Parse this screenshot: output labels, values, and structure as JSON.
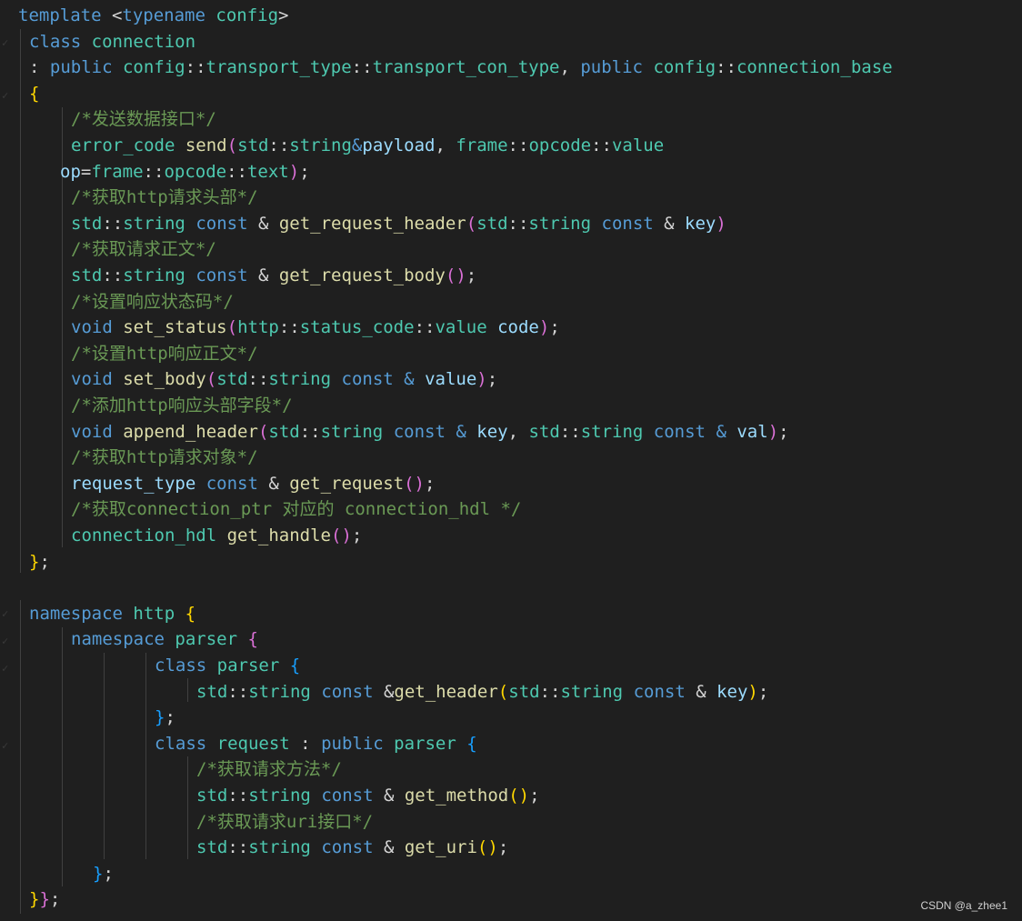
{
  "colors": {
    "background": "#1f1f1f",
    "keyword": "#569cd6",
    "type": "#4ec9b0",
    "function": "#dcdcaa",
    "variable": "#9cdcfe",
    "comment": "#6a9955",
    "punctuation": "#d4d4d4",
    "bracket_1": "#ffd700",
    "bracket_2": "#da70d6",
    "bracket_3": "#179fff"
  },
  "watermark": "CSDN @a_zhee1",
  "code_lines": [
    [
      [
        "kw",
        "template"
      ],
      [
        "punc",
        " <"
      ],
      [
        "kw",
        "typename"
      ],
      [
        "punc",
        " "
      ],
      [
        "type",
        "config"
      ],
      [
        "punc",
        ">"
      ]
    ],
    [
      [
        "kw",
        "class"
      ],
      [
        "punc",
        " "
      ],
      [
        "type",
        "connection"
      ]
    ],
    [
      [
        "punc",
        ": "
      ],
      [
        "kw",
        "public"
      ],
      [
        "punc",
        " "
      ],
      [
        "type",
        "config"
      ],
      [
        "punc",
        "::"
      ],
      [
        "type",
        "transport_type"
      ],
      [
        "punc",
        "::"
      ],
      [
        "type",
        "transport_con_type"
      ],
      [
        "punc",
        ", "
      ],
      [
        "kw",
        "public"
      ],
      [
        "punc",
        " "
      ],
      [
        "type",
        "config"
      ],
      [
        "punc",
        "::"
      ],
      [
        "type",
        "connection_base"
      ]
    ],
    [
      [
        "br1",
        "{"
      ]
    ],
    [
      [
        "com",
        "/*发送数据接口*/"
      ]
    ],
    [
      [
        "type",
        "error_code"
      ],
      [
        "punc",
        " "
      ],
      [
        "func",
        "send"
      ],
      [
        "br2",
        "("
      ],
      [
        "type",
        "std"
      ],
      [
        "punc",
        "::"
      ],
      [
        "type",
        "string"
      ],
      [
        "kw",
        "&"
      ],
      [
        "var",
        "payload"
      ],
      [
        "punc",
        ", "
      ],
      [
        "type",
        "frame"
      ],
      [
        "punc",
        "::"
      ],
      [
        "type",
        "opcode"
      ],
      [
        "punc",
        "::"
      ],
      [
        "type",
        "value"
      ]
    ],
    [
      [
        "var",
        "op"
      ],
      [
        "punc",
        "="
      ],
      [
        "type",
        "frame"
      ],
      [
        "punc",
        "::"
      ],
      [
        "type",
        "opcode"
      ],
      [
        "punc",
        "::"
      ],
      [
        "type",
        "text"
      ],
      [
        "br2",
        ")"
      ],
      [
        "punc",
        ";"
      ]
    ],
    [
      [
        "com",
        "/*获取http请求头部*/"
      ]
    ],
    [
      [
        "type",
        "std"
      ],
      [
        "punc",
        "::"
      ],
      [
        "type",
        "string"
      ],
      [
        "punc",
        " "
      ],
      [
        "kw",
        "const"
      ],
      [
        "punc",
        " & "
      ],
      [
        "func",
        "get_request_header"
      ],
      [
        "br2",
        "("
      ],
      [
        "type",
        "std"
      ],
      [
        "punc",
        "::"
      ],
      [
        "type",
        "string"
      ],
      [
        "punc",
        " "
      ],
      [
        "kw",
        "const"
      ],
      [
        "punc",
        " & "
      ],
      [
        "var",
        "key"
      ],
      [
        "br2",
        ")"
      ]
    ],
    [
      [
        "com",
        "/*获取请求正文*/"
      ]
    ],
    [
      [
        "type",
        "std"
      ],
      [
        "punc",
        "::"
      ],
      [
        "type",
        "string"
      ],
      [
        "punc",
        " "
      ],
      [
        "kw",
        "const"
      ],
      [
        "punc",
        " & "
      ],
      [
        "func",
        "get_request_body"
      ],
      [
        "br2",
        "()"
      ],
      [
        "punc",
        ";"
      ]
    ],
    [
      [
        "com",
        "/*设置响应状态码*/"
      ]
    ],
    [
      [
        "kw",
        "void"
      ],
      [
        "punc",
        " "
      ],
      [
        "func",
        "set_status"
      ],
      [
        "br2",
        "("
      ],
      [
        "type",
        "http"
      ],
      [
        "punc",
        "::"
      ],
      [
        "type",
        "status_code"
      ],
      [
        "punc",
        "::"
      ],
      [
        "type",
        "value"
      ],
      [
        "punc",
        " "
      ],
      [
        "var",
        "code"
      ],
      [
        "br2",
        ")"
      ],
      [
        "punc",
        ";"
      ]
    ],
    [
      [
        "com",
        "/*设置http响应正文*/"
      ]
    ],
    [
      [
        "kw",
        "void"
      ],
      [
        "punc",
        " "
      ],
      [
        "func",
        "set_body"
      ],
      [
        "br2",
        "("
      ],
      [
        "type",
        "std"
      ],
      [
        "punc",
        "::"
      ],
      [
        "type",
        "string"
      ],
      [
        "punc",
        " "
      ],
      [
        "kw",
        "const"
      ],
      [
        "punc",
        " "
      ],
      [
        "kw",
        "&"
      ],
      [
        "punc",
        " "
      ],
      [
        "var",
        "value"
      ],
      [
        "br2",
        ")"
      ],
      [
        "punc",
        ";"
      ]
    ],
    [
      [
        "com",
        "/*添加http响应头部字段*/"
      ]
    ],
    [
      [
        "kw",
        "void"
      ],
      [
        "punc",
        " "
      ],
      [
        "func",
        "append_header"
      ],
      [
        "br2",
        "("
      ],
      [
        "type",
        "std"
      ],
      [
        "punc",
        "::"
      ],
      [
        "type",
        "string"
      ],
      [
        "punc",
        " "
      ],
      [
        "kw",
        "const"
      ],
      [
        "punc",
        " "
      ],
      [
        "kw",
        "&"
      ],
      [
        "punc",
        " "
      ],
      [
        "var",
        "key"
      ],
      [
        "punc",
        ", "
      ],
      [
        "type",
        "std"
      ],
      [
        "punc",
        "::"
      ],
      [
        "type",
        "string"
      ],
      [
        "punc",
        " "
      ],
      [
        "kw",
        "const"
      ],
      [
        "punc",
        " "
      ],
      [
        "kw",
        "&"
      ],
      [
        "punc",
        " "
      ],
      [
        "var",
        "val"
      ],
      [
        "br2",
        ")"
      ],
      [
        "punc",
        ";"
      ]
    ],
    [
      [
        "com",
        "/*获取http请求对象*/"
      ]
    ],
    [
      [
        "var",
        "request_type"
      ],
      [
        "punc",
        " "
      ],
      [
        "kw",
        "const"
      ],
      [
        "punc",
        " & "
      ],
      [
        "func",
        "get_request"
      ],
      [
        "br2",
        "()"
      ],
      [
        "punc",
        ";"
      ]
    ],
    [
      [
        "com",
        "/*获取connection_ptr 对应的 connection_hdl */"
      ]
    ],
    [
      [
        "type",
        "connection_hdl"
      ],
      [
        "punc",
        " "
      ],
      [
        "func",
        "get_handle"
      ],
      [
        "br2",
        "()"
      ],
      [
        "punc",
        ";"
      ]
    ],
    [
      [
        "br1",
        "}"
      ],
      [
        "punc",
        ";"
      ]
    ],
    [],
    [
      [
        "kw",
        "namespace"
      ],
      [
        "punc",
        " "
      ],
      [
        "type",
        "http"
      ],
      [
        "punc",
        " "
      ],
      [
        "br1",
        "{"
      ]
    ],
    [
      [
        "kw",
        "namespace"
      ],
      [
        "punc",
        " "
      ],
      [
        "type",
        "parser"
      ],
      [
        "punc",
        " "
      ],
      [
        "br2",
        "{"
      ]
    ],
    [
      [
        "kw",
        "class"
      ],
      [
        "punc",
        " "
      ],
      [
        "type",
        "parser"
      ],
      [
        "punc",
        " "
      ],
      [
        "br3",
        "{"
      ]
    ],
    [
      [
        "type",
        "std"
      ],
      [
        "punc",
        "::"
      ],
      [
        "type",
        "string"
      ],
      [
        "punc",
        " "
      ],
      [
        "kw",
        "const"
      ],
      [
        "punc",
        " &"
      ],
      [
        "func",
        "get_header"
      ],
      [
        "br1",
        "("
      ],
      [
        "type",
        "std"
      ],
      [
        "punc",
        "::"
      ],
      [
        "type",
        "string"
      ],
      [
        "punc",
        " "
      ],
      [
        "kw",
        "const"
      ],
      [
        "punc",
        " & "
      ],
      [
        "var",
        "key"
      ],
      [
        "br1",
        ")"
      ],
      [
        "punc",
        ";"
      ]
    ],
    [
      [
        "br3",
        "}"
      ],
      [
        "punc",
        ";"
      ]
    ],
    [
      [
        "kw",
        "class"
      ],
      [
        "punc",
        " "
      ],
      [
        "type",
        "request"
      ],
      [
        "punc",
        " : "
      ],
      [
        "kw",
        "public"
      ],
      [
        "punc",
        " "
      ],
      [
        "type",
        "parser"
      ],
      [
        "punc",
        " "
      ],
      [
        "br3",
        "{"
      ]
    ],
    [
      [
        "com",
        "/*获取请求方法*/"
      ]
    ],
    [
      [
        "type",
        "std"
      ],
      [
        "punc",
        "::"
      ],
      [
        "type",
        "string"
      ],
      [
        "punc",
        " "
      ],
      [
        "kw",
        "const"
      ],
      [
        "punc",
        " & "
      ],
      [
        "func",
        "get_method"
      ],
      [
        "br1",
        "()"
      ],
      [
        "punc",
        ";"
      ]
    ],
    [
      [
        "com",
        "/*获取请求uri接口*/"
      ]
    ],
    [
      [
        "type",
        "std"
      ],
      [
        "punc",
        "::"
      ],
      [
        "type",
        "string"
      ],
      [
        "punc",
        " "
      ],
      [
        "kw",
        "const"
      ],
      [
        "punc",
        " & "
      ],
      [
        "func",
        "get_uri"
      ],
      [
        "br1",
        "()"
      ],
      [
        "punc",
        ";"
      ]
    ],
    [
      [
        "br3",
        "}"
      ],
      [
        "punc",
        ";"
      ]
    ],
    [
      [
        "br1",
        "}"
      ],
      [
        "br2",
        "}"
      ],
      [
        "punc",
        ";"
      ]
    ]
  ]
}
